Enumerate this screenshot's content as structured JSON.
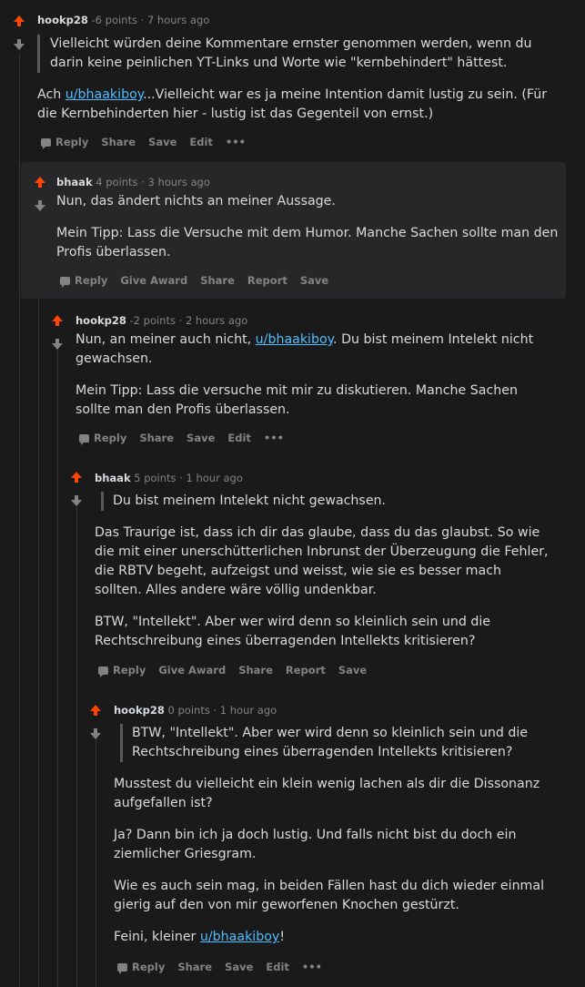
{
  "comments": [
    {
      "user": "hookp28",
      "points": "-6 points",
      "time": "7 hours ago",
      "quote": "Vielleicht würden deine Kommentare ernster genommen werden, wenn du darin keine peinlichen YT-Links und Worte wie \"kernbehindert\" hättest.",
      "p1_pre": "Ach ",
      "p1_link": "u/bhaakiboy",
      "p1_post": "...Vielleicht war es ja meine Intention damit lustig zu sein. (Für die Kernbehinderten hier - lustig ist das Gegenteil von ernst.)",
      "actions": [
        "Reply",
        "Share",
        "Save",
        "Edit",
        "•••"
      ]
    },
    {
      "user": "bhaak",
      "points": "4 points",
      "time": "3 hours ago",
      "p1": "Nun, das ändert nichts an meiner Aussage.",
      "p2": "Mein Tipp: Lass die Versuche mit dem Humor. Manche Sachen sollte man den Profis überlassen.",
      "actions": [
        "Reply",
        "Give Award",
        "Share",
        "Report",
        "Save"
      ]
    },
    {
      "user": "hookp28",
      "points": "-2 points",
      "time": "2 hours ago",
      "p1_pre": "Nun, an meiner auch nicht, ",
      "p1_link": "u/bhaakiboy",
      "p1_post": ". Du bist meinem Intelekt nicht gewachsen.",
      "p2": "Mein Tipp: Lass die versuche mit mir zu diskutieren. Manche Sachen sollte man den Profis überlassen.",
      "actions": [
        "Reply",
        "Share",
        "Save",
        "Edit",
        "•••"
      ]
    },
    {
      "user": "bhaak",
      "points": "5 points",
      "time": "1 hour ago",
      "quote": "Du bist meinem Intelekt nicht gewachsen.",
      "p1": "Das Traurige ist, dass ich dir das glaube, dass du das glaubst. So wie die mit einer unerschütterlichen Inbrunst der Überzeugung die Fehler, die RBTV begeht, aufzeigst und weisst, wie sie es besser mach sollten. Alles andere wäre völlig undenkbar.",
      "p2": "BTW, \"Intellekt\". Aber wer wird denn so kleinlich sein und die Rechtschreibung eines überragenden Intellekts kritisieren?",
      "actions": [
        "Reply",
        "Give Award",
        "Share",
        "Report",
        "Save"
      ]
    },
    {
      "user": "hookp28",
      "points": "0 points",
      "time": "1 hour ago",
      "quote": "BTW, \"Intellekt\". Aber wer wird denn so kleinlich sein und die Rechtschreibung eines überragenden Intellekts kritisieren?",
      "p1": "Musstest du vielleicht ein klein wenig lachen als dir die Dissonanz aufgefallen ist?",
      "p2": "Ja? Dann bin ich ja doch lustig. Und falls nicht bist du doch ein ziemlicher Griesgram.",
      "p3": "Wie es auch sein mag, in beiden Fällen hast du dich wieder einmal gierig auf den von mir geworfenen Knochen gestürzt.",
      "p4_pre": "Feini, kleiner ",
      "p4_link": "u/bhaakiboy",
      "p4_post": "!",
      "actions": [
        "Reply",
        "Share",
        "Save",
        "Edit",
        "•••"
      ]
    }
  ]
}
